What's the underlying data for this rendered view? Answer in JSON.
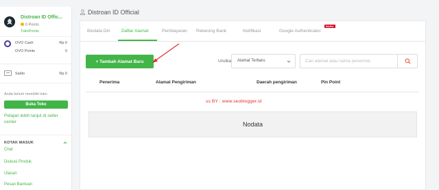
{
  "sidebar": {
    "shop_name": "Distroan ID Offic...",
    "points": "0 Points",
    "tokopoints": "TokoPoints",
    "ovo_cash_label": "OVO Cash",
    "ovo_cash_value": "Rp 0",
    "ovo_points_label": "OVO Points",
    "ovo_points_value": "0",
    "saldo_label": "Saldo",
    "saldo_value": "Rp 0",
    "no_shop_text": "Anda belum memiliki toko",
    "open_shop_button": "Buka Toko",
    "learn_more_link": "Pelajari lebih lanjut di seller center",
    "inbox_title": "KOTAK MASUK",
    "inbox_items": [
      "Chat",
      "Diskusi Produk",
      "Ulasan",
      "Pesan Bantuan"
    ]
  },
  "page": {
    "title": "Distroan ID Official"
  },
  "tabs": [
    {
      "label": "Biodata Diri",
      "active": false
    },
    {
      "label": "Daftar Alamat",
      "active": true
    },
    {
      "label": "Pembayaran",
      "active": false
    },
    {
      "label": "Rekening Bank",
      "active": false
    },
    {
      "label": "Notifikasi",
      "active": false
    },
    {
      "label": "Google Authenticator",
      "active": false,
      "badge": "BARU"
    }
  ],
  "toolbar": {
    "add_button": "+ Tambah Alamat Baru",
    "sort_label": "Urutkan",
    "sort_value": "Alamat Terbaru",
    "search_placeholder": "Cari alamat atau nama penerima"
  },
  "table": {
    "headers": [
      "Penerima",
      "Alamat Pengiriman",
      "Daerah pengiriman",
      "Pin Point"
    ],
    "watermark": "ss BY :   www.seoblogger.id",
    "empty_text": "Nodata"
  },
  "colors": {
    "accent": "#42b549",
    "badge": "#d0021b",
    "arrow": "#e02b2b",
    "ovo": "#4c3494"
  }
}
